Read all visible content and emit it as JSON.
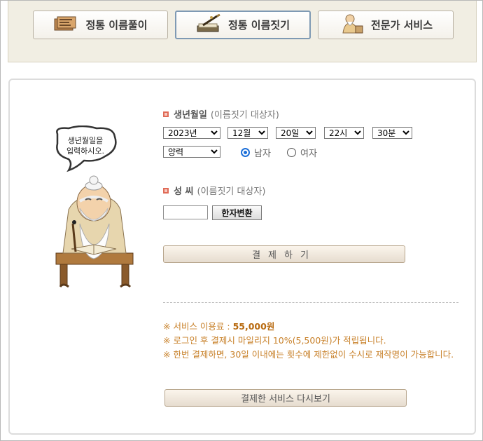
{
  "tabs": [
    {
      "label": "정통 이름풀이",
      "icon": "book-scroll-icon",
      "active": false
    },
    {
      "label": "정통 이름짓기",
      "icon": "brush-writing-icon",
      "active": true
    },
    {
      "label": "전문가 서비스",
      "icon": "sage-master-icon",
      "active": false
    }
  ],
  "mascot": {
    "speech": [
      "생년월일을",
      "입력하시오."
    ]
  },
  "birth": {
    "label": "생년월일",
    "sub": "(이름짓기 대상자)",
    "year": "2023년",
    "month": "12월",
    "day": "20일",
    "hour": "22시",
    "minute": "30분",
    "calendar": "양력",
    "gender_male": "남자",
    "gender_female": "여자"
  },
  "surname": {
    "label": "성 씨",
    "sub": "(이름짓기 대상자)",
    "value": "",
    "convert_button": "한자변환"
  },
  "pay_button": "결제하기",
  "notes": {
    "fee_prefix": "※ 서비스 이용료 : ",
    "fee_value": "55,000원",
    "line2": "※ 로그인 후 결제시 마일리지 10%(5,500원)가 적립됩니다.",
    "line3": "※ 한번 결제하면, 30일 이내에는 횟수에 제한없이 수시로 재작명이 가능합니다."
  },
  "review_button": "결제한 서비스 다시보기",
  "colors": {
    "accent_bullet": "#e06b57",
    "note_text": "#c8812a",
    "active_tab_border": "#7f9ab4"
  }
}
